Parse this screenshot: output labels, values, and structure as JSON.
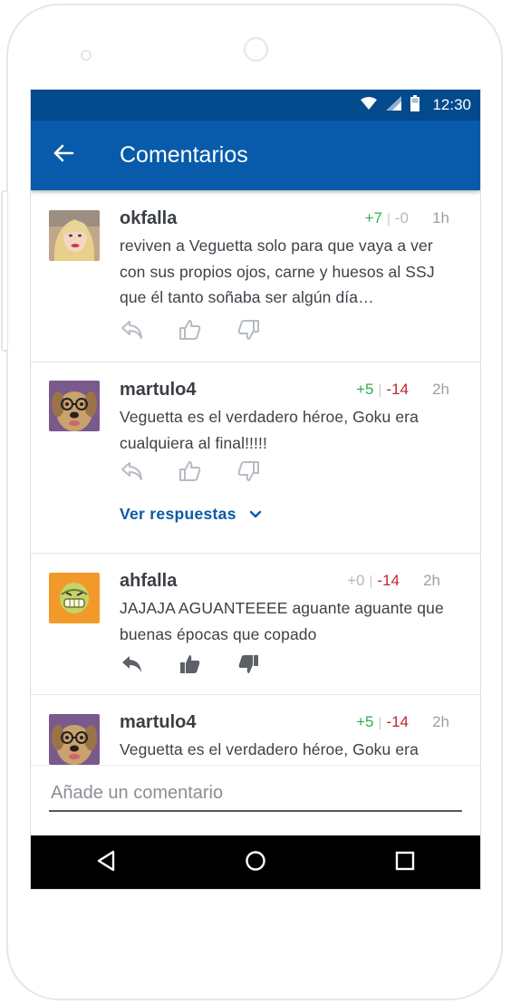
{
  "status_bar": {
    "time": "12:30"
  },
  "app_bar": {
    "title": "Comentarios"
  },
  "comments": [
    {
      "author": "okfalla",
      "upvotes": "+7",
      "downvotes": "-0",
      "time": "1h",
      "text": "reviven a Veguetta solo para que vaya a ver con sus propios ojos, carne y huesos al SSJ que él tanto soñaba ser algún día…"
    },
    {
      "author": "martulo4",
      "upvotes": "+5",
      "downvotes": "-14",
      "time": "2h",
      "text": "Veguetta es el verdadero héroe, Goku era cualquiera al final!!!!!",
      "view_replies": "Ver respuestas"
    },
    {
      "author": "ahfalla",
      "upvotes": "+0",
      "downvotes": "-14",
      "time": "2h",
      "text": "JAJAJA AGUANTEEEE aguante aguante que buenas épocas que copado"
    },
    {
      "author": "martulo4",
      "upvotes": "+5",
      "downvotes": "-14",
      "time": "2h",
      "text": "Veguetta es el verdadero héroe, Goku era"
    }
  ],
  "input": {
    "placeholder": "Añade un comentario"
  },
  "colors": {
    "status_bar": "#034a8c",
    "app_bar": "#075baa",
    "positive": "#2fae4c",
    "negative": "#c0272d",
    "link": "#0b5aa6"
  },
  "icons": [
    "wifi-icon",
    "signal-icon",
    "battery-icon",
    "back-arrow-icon",
    "reply-icon",
    "thumbs-up-icon",
    "thumbs-down-icon",
    "chevron-down-icon",
    "nav-back-icon",
    "nav-home-icon",
    "nav-recents-icon"
  ]
}
